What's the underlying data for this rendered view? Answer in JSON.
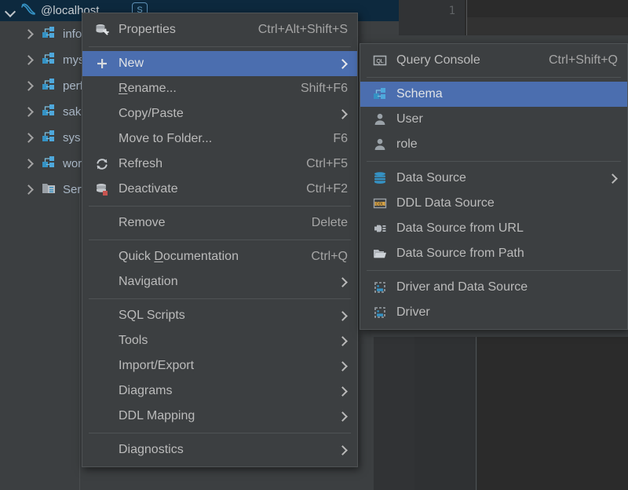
{
  "tool_window": {
    "title": "@localhost",
    "connection_badge": "S",
    "tree": [
      {
        "label": "information_schema",
        "icon": "schema-icon"
      },
      {
        "label": "mysql",
        "icon": "schema-icon"
      },
      {
        "label": "performance_schema",
        "icon": "schema-icon"
      },
      {
        "label": "sakila",
        "icon": "schema-icon"
      },
      {
        "label": "sys",
        "icon": "schema-icon"
      },
      {
        "label": "world",
        "icon": "schema-icon"
      },
      {
        "label": "Server Objects",
        "icon": "server-objects-icon"
      }
    ]
  },
  "editor": {
    "line_number": "1"
  },
  "context_menu": {
    "items": [
      {
        "type": "item",
        "label": "Properties",
        "shortcut": "Ctrl+Alt+Shift+S",
        "icon": "properties-icon",
        "arrow": false,
        "selected": false
      },
      {
        "type": "separator"
      },
      {
        "type": "item",
        "label": "New",
        "shortcut": "",
        "icon": "plus-icon",
        "arrow": true,
        "selected": true
      },
      {
        "type": "item",
        "label": "Rename...",
        "shortcut": "Shift+F6",
        "icon": "",
        "arrow": false,
        "selected": false,
        "mnemonic": "R"
      },
      {
        "type": "item",
        "label": "Copy/Paste",
        "shortcut": "",
        "icon": "",
        "arrow": true,
        "selected": false
      },
      {
        "type": "item",
        "label": "Move to Folder...",
        "shortcut": "F6",
        "icon": "",
        "arrow": false,
        "selected": false
      },
      {
        "type": "item",
        "label": "Refresh",
        "shortcut": "Ctrl+F5",
        "icon": "refresh-icon",
        "arrow": false,
        "selected": false
      },
      {
        "type": "item",
        "label": "Deactivate",
        "shortcut": "Ctrl+F2",
        "icon": "deactivate-icon",
        "arrow": false,
        "selected": false
      },
      {
        "type": "separator"
      },
      {
        "type": "item",
        "label": "Remove",
        "shortcut": "Delete",
        "icon": "",
        "arrow": false,
        "selected": false
      },
      {
        "type": "separator"
      },
      {
        "type": "item",
        "label": "Quick Documentation",
        "shortcut": "Ctrl+Q",
        "icon": "",
        "arrow": false,
        "selected": false,
        "mnemonic": "D"
      },
      {
        "type": "item",
        "label": "Navigation",
        "shortcut": "",
        "icon": "",
        "arrow": true,
        "selected": false
      },
      {
        "type": "separator"
      },
      {
        "type": "item",
        "label": "SQL Scripts",
        "shortcut": "",
        "icon": "",
        "arrow": true,
        "selected": false
      },
      {
        "type": "item",
        "label": "Tools",
        "shortcut": "",
        "icon": "",
        "arrow": true,
        "selected": false
      },
      {
        "type": "item",
        "label": "Import/Export",
        "shortcut": "",
        "icon": "",
        "arrow": true,
        "selected": false
      },
      {
        "type": "item",
        "label": "Diagrams",
        "shortcut": "",
        "icon": "",
        "arrow": true,
        "selected": false
      },
      {
        "type": "item",
        "label": "DDL Mapping",
        "shortcut": "",
        "icon": "",
        "arrow": true,
        "selected": false
      },
      {
        "type": "separator"
      },
      {
        "type": "item",
        "label": "Diagnostics",
        "shortcut": "",
        "icon": "",
        "arrow": true,
        "selected": false
      }
    ]
  },
  "new_submenu": {
    "items": [
      {
        "type": "item",
        "label": "Query Console",
        "shortcut": "Ctrl+Shift+Q",
        "icon": "query-console-icon",
        "arrow": false,
        "selected": false
      },
      {
        "type": "separator"
      },
      {
        "type": "item",
        "label": "Schema",
        "shortcut": "",
        "icon": "schema-icon",
        "arrow": false,
        "selected": true
      },
      {
        "type": "item",
        "label": "User",
        "shortcut": "",
        "icon": "user-icon",
        "arrow": false,
        "selected": false
      },
      {
        "type": "item",
        "label": "role",
        "shortcut": "",
        "icon": "user-icon",
        "arrow": false,
        "selected": false
      },
      {
        "type": "separator"
      },
      {
        "type": "item",
        "label": "Data Source",
        "shortcut": "",
        "icon": "database-icon",
        "arrow": true,
        "selected": false
      },
      {
        "type": "item",
        "label": "DDL Data Source",
        "shortcut": "",
        "icon": "ddl-icon",
        "arrow": false,
        "selected": false
      },
      {
        "type": "item",
        "label": "Data Source from URL",
        "shortcut": "",
        "icon": "plug-icon",
        "arrow": false,
        "selected": false
      },
      {
        "type": "item",
        "label": "Data Source from Path",
        "shortcut": "",
        "icon": "folder-icon",
        "arrow": false,
        "selected": false
      },
      {
        "type": "separator"
      },
      {
        "type": "item",
        "label": "Driver and Data Source",
        "shortcut": "",
        "icon": "driver-icon",
        "arrow": false,
        "selected": false
      },
      {
        "type": "item",
        "label": "Driver",
        "shortcut": "",
        "icon": "driver-icon",
        "arrow": false,
        "selected": false
      }
    ]
  },
  "colors": {
    "menu_background": "#3c3f41",
    "selection_blue": "#4b6eaf",
    "titlebar_blue": "#0d293e",
    "icon_blue": "#3592c4",
    "editor_background": "#2b2b2b"
  }
}
